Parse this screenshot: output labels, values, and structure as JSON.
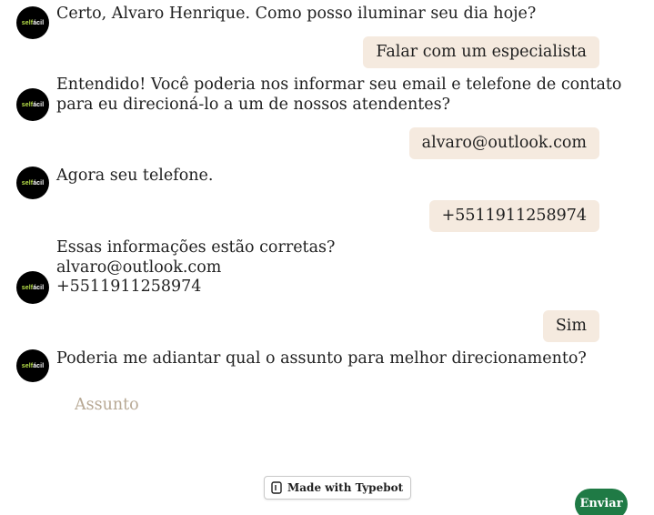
{
  "colors": {
    "user_bubble": "#f5eadf",
    "send_button": "#1f7a45",
    "placeholder": "#b8a995",
    "avatar_bg": "#000000",
    "avatar_accent": "#b8e04a"
  },
  "avatar": {
    "part1": "self",
    "part2": "ácil"
  },
  "messages": [
    {
      "from": "bot",
      "text": "Certo, Alvaro Henrique. Como posso iluminar seu dia hoje?"
    },
    {
      "from": "user",
      "text": "Falar com um especialista"
    },
    {
      "from": "bot",
      "text": "Entendido! Você poderia nos informar seu email e telefone de contato\npara eu direcioná-lo a um de nossos atendentes?"
    },
    {
      "from": "user",
      "text": "alvaro@outlook.com"
    },
    {
      "from": "bot",
      "text": "Agora seu telefone."
    },
    {
      "from": "user",
      "text": "+5511911258974"
    },
    {
      "from": "bot",
      "text": "Essas informações estão corretas?\nalvaro@outlook.com\n+5511911258974"
    },
    {
      "from": "user",
      "text": "Sim"
    },
    {
      "from": "bot",
      "text": "Poderia me adiantar qual o assunto para melhor direcionamento?"
    }
  ],
  "input": {
    "placeholder": "Assunto",
    "value": ""
  },
  "badge": {
    "label": "Made with Typebot",
    "icon": "typebot-logo-icon"
  },
  "send_button": {
    "label": "Enviar"
  }
}
